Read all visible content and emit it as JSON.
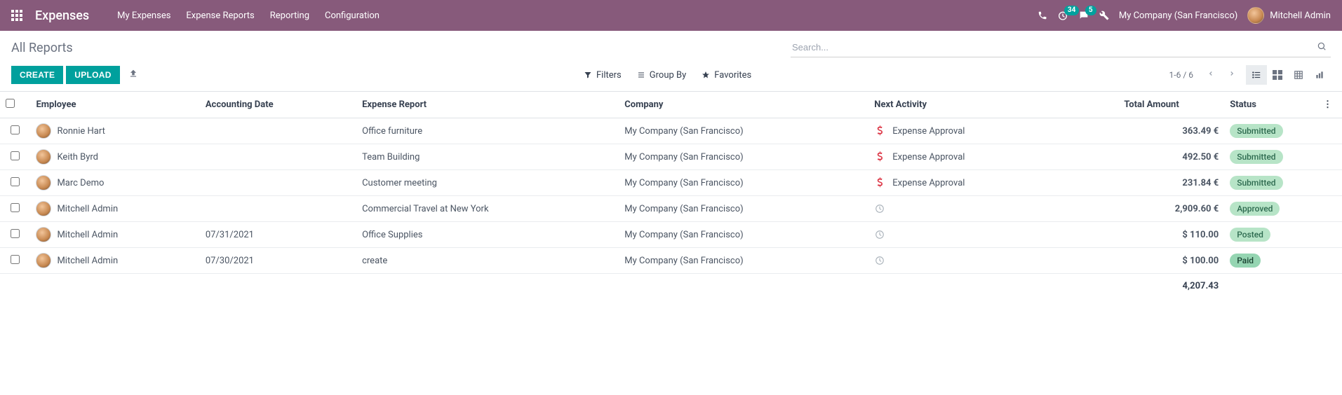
{
  "nav": {
    "brand": "Expenses",
    "menu": [
      "My Expenses",
      "Expense Reports",
      "Reporting",
      "Configuration"
    ],
    "timer_badge": "34",
    "chat_badge": "5",
    "company": "My Company (San Francisco)",
    "user": "Mitchell Admin"
  },
  "cp": {
    "title": "All Reports",
    "search_placeholder": "Search...",
    "create": "CREATE",
    "upload": "UPLOAD",
    "filters": "Filters",
    "group_by": "Group By",
    "favorites": "Favorites",
    "pager": "1-6 / 6"
  },
  "table": {
    "headers": {
      "employee": "Employee",
      "accounting_date": "Accounting Date",
      "expense_report": "Expense Report",
      "company": "Company",
      "next_activity": "Next Activity",
      "total_amount": "Total Amount",
      "status": "Status"
    },
    "rows": [
      {
        "employee": "Ronnie Hart",
        "date": "",
        "report": "Office furniture",
        "company": "My Company (San Francisco)",
        "activity": "Expense Approval",
        "activity_kind": "danger",
        "amount": "363.49 €",
        "status": "Submitted",
        "status_class": "status-submitted"
      },
      {
        "employee": "Keith Byrd",
        "date": "",
        "report": "Team Building",
        "company": "My Company (San Francisco)",
        "activity": "Expense Approval",
        "activity_kind": "danger",
        "amount": "492.50 €",
        "status": "Submitted",
        "status_class": "status-submitted"
      },
      {
        "employee": "Marc Demo",
        "date": "",
        "report": "Customer meeting",
        "company": "My Company (San Francisco)",
        "activity": "Expense Approval",
        "activity_kind": "danger",
        "amount": "231.84 €",
        "status": "Submitted",
        "status_class": "status-submitted"
      },
      {
        "employee": "Mitchell Admin",
        "date": "",
        "report": "Commercial Travel at New York",
        "company": "My Company (San Francisco)",
        "activity": "",
        "activity_kind": "muted",
        "amount": "2,909.60 €",
        "status": "Approved",
        "status_class": "status-approved"
      },
      {
        "employee": "Mitchell Admin",
        "date": "07/31/2021",
        "report": "Office Supplies",
        "company": "My Company (San Francisco)",
        "activity": "",
        "activity_kind": "muted",
        "amount": "$ 110.00",
        "status": "Posted",
        "status_class": "status-posted"
      },
      {
        "employee": "Mitchell Admin",
        "date": "07/30/2021",
        "report": "create",
        "company": "My Company (San Francisco)",
        "activity": "",
        "activity_kind": "muted",
        "amount": "$ 100.00",
        "status": "Paid",
        "status_class": "status-paid"
      }
    ],
    "footer_total": "4,207.43"
  }
}
